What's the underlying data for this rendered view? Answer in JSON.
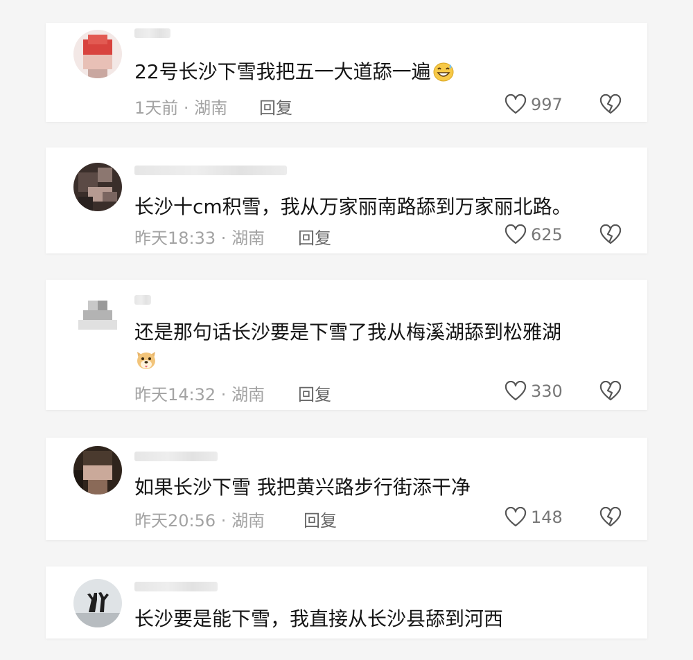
{
  "comments": [
    {
      "text": "22号长沙下雪我把五一大道舔一遍",
      "emoji": "grinning-sweat-emoji",
      "time": "1天前",
      "location": "湖南",
      "reply_label": "回复",
      "likes": "997"
    },
    {
      "text": "长沙十cm积雪，我从万家丽南路舔到万家丽北路。",
      "time": "昨天18:33",
      "location": "湖南",
      "reply_label": "回复",
      "likes": "625"
    },
    {
      "text": "还是那句话长沙要是下雪了我从梅溪湖舔到松雅湖",
      "emoji": "dog-emoji",
      "time": "昨天14:32",
      "location": "湖南",
      "reply_label": "回复",
      "likes": "330"
    },
    {
      "text": "如果长沙下雪 我把黄兴路步行街添干净",
      "time": "昨天20:56",
      "location": "湖南",
      "reply_label": "回复",
      "likes": "148"
    },
    {
      "text": "长沙要是能下雪，我直接从长沙县舔到河西"
    }
  ],
  "separator": " · ",
  "icons": {
    "like": "heart-outline-icon",
    "dislike": "broken-heart-icon"
  },
  "colors": {
    "text": "#151515",
    "meta": "#a3a3a3",
    "reply": "#666666",
    "card": "#ffffff",
    "background": "#f5f5f5"
  }
}
